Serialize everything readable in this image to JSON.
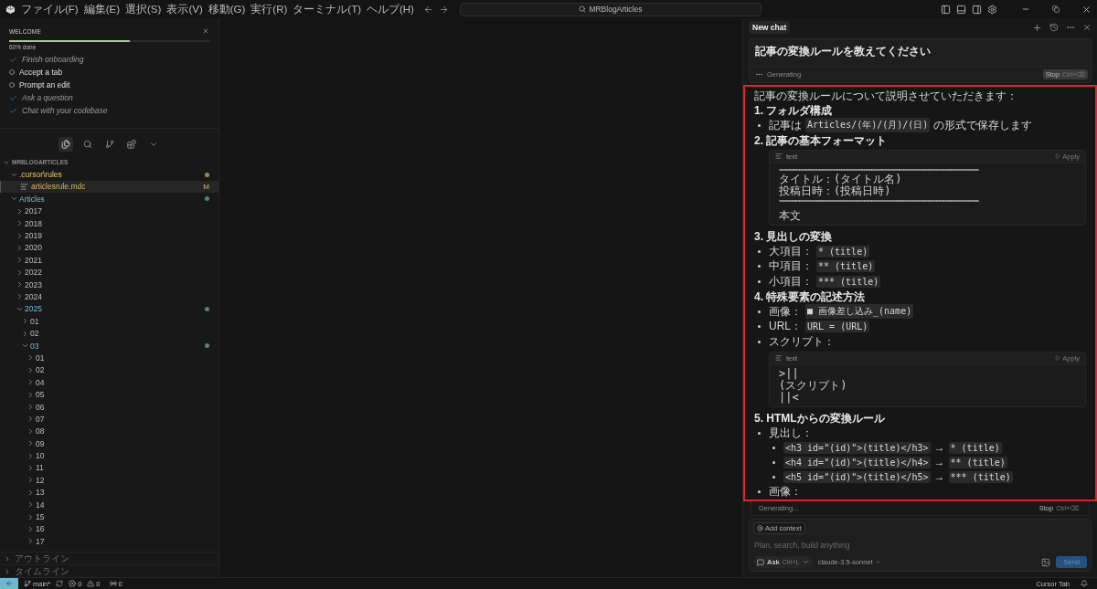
{
  "title_bar": {
    "menu": [
      "ファイル(F)",
      "編集(E)",
      "選択(S)",
      "表示(V)",
      "移動(G)",
      "実行(R)",
      "ターミナル(T)",
      "ヘルプ(H)"
    ],
    "search": {
      "value": "MRBlogArticles"
    }
  },
  "welcome": {
    "title": "WELCOME",
    "level": 0.6,
    "progress_label": "60% done",
    "tasks": [
      {
        "label": "Finish onboarding",
        "done": true
      },
      {
        "label": "Accept a tab",
        "done": false
      },
      {
        "label": "Prompt an edit",
        "done": false
      },
      {
        "label": "Ask a question",
        "done": true
      },
      {
        "label": "Chat with your codebase",
        "done": true
      }
    ]
  },
  "activity_tabs": [
    {
      "selected": true
    },
    {
      "selected": false
    },
    {
      "selected": false
    },
    {
      "selected": false
    }
  ],
  "explorer": {
    "title": "MRBLOGARTICLES",
    "expanded": true,
    "tree": [
      {
        "label": ".cursor\\rules",
        "kind": "folder",
        "expanded": true,
        "selected": false,
        "color": "#a08a4e",
        "children": [
          {
            "label": "articlesrule.mdc",
            "kind": "file",
            "selected": true,
            "badge": "M"
          }
        ]
      },
      {
        "label": "Articles",
        "kind": "folder",
        "expanded": true,
        "selected": false,
        "color": "#4f8293",
        "children": [
          {
            "label": "2017",
            "kind": "folder",
            "expanded": false,
            "selected": false
          },
          {
            "label": "2018",
            "kind": "folder",
            "expanded": false,
            "selected": false
          },
          {
            "label": "2019",
            "kind": "folder",
            "expanded": false,
            "selected": false
          },
          {
            "label": "2020",
            "kind": "folder",
            "expanded": false,
            "selected": false
          },
          {
            "label": "2021",
            "kind": "folder",
            "expanded": false,
            "selected": false
          },
          {
            "label": "2022",
            "kind": "folder",
            "expanded": false,
            "selected": false
          },
          {
            "label": "2023",
            "kind": "folder",
            "expanded": false,
            "selected": false
          },
          {
            "label": "2024",
            "kind": "folder",
            "expanded": false,
            "selected": false
          },
          {
            "label": "2025",
            "kind": "folder",
            "expanded": true,
            "selected": false,
            "color": "#4f8293",
            "children": [
              {
                "label": "01",
                "kind": "folder",
                "expanded": false,
                "selected": false
              },
              {
                "label": "02",
                "kind": "folder",
                "expanded": false,
                "selected": false
              },
              {
                "label": "03",
                "kind": "folder",
                "expanded": true,
                "selected": false,
                "color": "#4f8293",
                "children": [
                  {
                    "label": "01",
                    "kind": "folder",
                    "expanded": false,
                    "selected": false
                  },
                  {
                    "label": "02",
                    "kind": "folder",
                    "expanded": false,
                    "selected": false
                  },
                  {
                    "label": "04",
                    "kind": "folder",
                    "expanded": false,
                    "selected": false
                  },
                  {
                    "label": "05",
                    "kind": "folder",
                    "expanded": false,
                    "selected": false
                  },
                  {
                    "label": "06",
                    "kind": "folder",
                    "expanded": false,
                    "selected": false
                  },
                  {
                    "label": "07",
                    "kind": "folder",
                    "expanded": false,
                    "selected": false
                  },
                  {
                    "label": "08",
                    "kind": "folder",
                    "expanded": false,
                    "selected": false
                  },
                  {
                    "label": "09",
                    "kind": "folder",
                    "expanded": false,
                    "selected": false
                  },
                  {
                    "label": "10",
                    "kind": "folder",
                    "expanded": false,
                    "selected": false
                  },
                  {
                    "label": "11",
                    "kind": "folder",
                    "expanded": false,
                    "selected": false
                  },
                  {
                    "label": "12",
                    "kind": "folder",
                    "expanded": false,
                    "selected": false
                  },
                  {
                    "label": "13",
                    "kind": "folder",
                    "expanded": false,
                    "selected": false
                  },
                  {
                    "label": "14",
                    "kind": "folder",
                    "expanded": false,
                    "selected": false
                  },
                  {
                    "label": "15",
                    "kind": "folder",
                    "expanded": false,
                    "selected": false
                  },
                  {
                    "label": "16",
                    "kind": "folder",
                    "expanded": false,
                    "selected": false
                  },
                  {
                    "label": "17",
                    "kind": "folder",
                    "expanded": false,
                    "selected": false
                  }
                ]
              }
            ]
          }
        ]
      }
    ]
  },
  "panels": [
    {
      "label": "アウトライン",
      "expanded": false
    },
    {
      "label": "タイムライン",
      "expanded": false
    }
  ],
  "chat": {
    "tab": "New chat",
    "query": "記事の変換ルールを教えてください",
    "status": "Generating",
    "stop": "Stop",
    "stop_shortcut": "Ctrl+⌫",
    "response": [
      {
        "kind": "paragraph",
        "text": "記事の変換ルールについて説明させていただきます："
      },
      {
        "kind": "heading",
        "text": "1. フォルダ構成"
      },
      {
        "kind": "bullet",
        "segments": [
          {
            "text": "記事は",
            "code": false
          },
          {
            "text": "Articles/(年)/(月)/(日)",
            "code": true
          },
          {
            "text": "の形式で保存します",
            "code": false
          }
        ]
      },
      {
        "kind": "heading",
        "text": "2. 記事の基本フォーマット"
      },
      {
        "kind": "code",
        "language": "text",
        "apply": "Apply",
        "lines": [
          {
            "kind": "rule",
            "text": "================================================================================"
          },
          {
            "kind": "line",
            "text": "タイトル：(タイトル名)"
          },
          {
            "kind": "line",
            "text": "投稿日時：(投稿日時)"
          },
          {
            "kind": "rule",
            "text": "================================================================================"
          },
          {
            "kind": "blank"
          },
          {
            "kind": "line",
            "text": "本文"
          }
        ]
      },
      {
        "kind": "heading",
        "text": "3. 見出しの変換"
      },
      {
        "kind": "bullet",
        "segments": [
          {
            "text": "大項目：",
            "code": false
          },
          {
            "text": "* (title)",
            "code": true
          }
        ]
      },
      {
        "kind": "bullet",
        "segments": [
          {
            "text": "中項目：",
            "code": false
          },
          {
            "text": "** (title)",
            "code": true
          }
        ]
      },
      {
        "kind": "bullet",
        "segments": [
          {
            "text": "小項目：",
            "code": false
          },
          {
            "text": "*** (title)",
            "code": true
          }
        ]
      },
      {
        "kind": "heading",
        "text": "4. 特殊要素の記述方法"
      },
      {
        "kind": "bullet",
        "segments": [
          {
            "text": "画像：",
            "code": false
          },
          {
            "text": "■ 画像差し込み_(name)",
            "code": true
          }
        ]
      },
      {
        "kind": "bullet",
        "segments": [
          {
            "text": "URL：",
            "code": false
          },
          {
            "text": "URL = (URL)",
            "code": true
          }
        ]
      },
      {
        "kind": "bullet",
        "segments": [
          {
            "text": "スクリプト：",
            "code": false
          }
        ]
      },
      {
        "kind": "code",
        "language": "text",
        "apply": "Apply",
        "lines": [
          {
            "kind": "line",
            "text": ">||"
          },
          {
            "kind": "line",
            "text": "(スクリプト)"
          },
          {
            "kind": "line",
            "text": "||<"
          }
        ]
      },
      {
        "kind": "heading",
        "text": "5. HTMLからの変換ルール"
      },
      {
        "kind": "bullet",
        "segments": [
          {
            "text": "見出し：",
            "code": false
          }
        ],
        "children": [
          {
            "kind": "bullet",
            "segments": [
              {
                "text": "<h3 id=\"(id)\">(title)</h3>",
                "code": true
              },
              {
                "text": "→",
                "code": false
              },
              {
                "text": "* (title)",
                "code": true
              }
            ]
          },
          {
            "kind": "bullet",
            "segments": [
              {
                "text": "<h4 id=\"(id)\">(title)</h4>",
                "code": true
              },
              {
                "text": "→",
                "code": false
              },
              {
                "text": "** (title)",
                "code": true
              }
            ]
          },
          {
            "kind": "bullet",
            "segments": [
              {
                "text": "<h5 id=\"(id)\">(title)</h5>",
                "code": true
              },
              {
                "text": "→",
                "code": false
              },
              {
                "text": "*** (title)",
                "code": true
              }
            ]
          }
        ]
      },
      {
        "kind": "bullet",
        "segments": [
          {
            "text": "画像：",
            "code": false
          }
        ]
      }
    ],
    "footer_status": "Generating...",
    "footer_stop": "Stop",
    "footer_stop_shortcut": "Ctrl+⌫",
    "input": {
      "context_button": "Add context",
      "placeholder": "Plan, search, build anything",
      "mode": "Ask",
      "mode_shortcut": "Ctrl+L",
      "model": "claude-3.5-sonnet",
      "send": "Send"
    }
  },
  "status_bar": {
    "branch": "main*",
    "errors": "0",
    "warnings": "0",
    "ports": "0",
    "right_label": "Cursor Tab"
  }
}
